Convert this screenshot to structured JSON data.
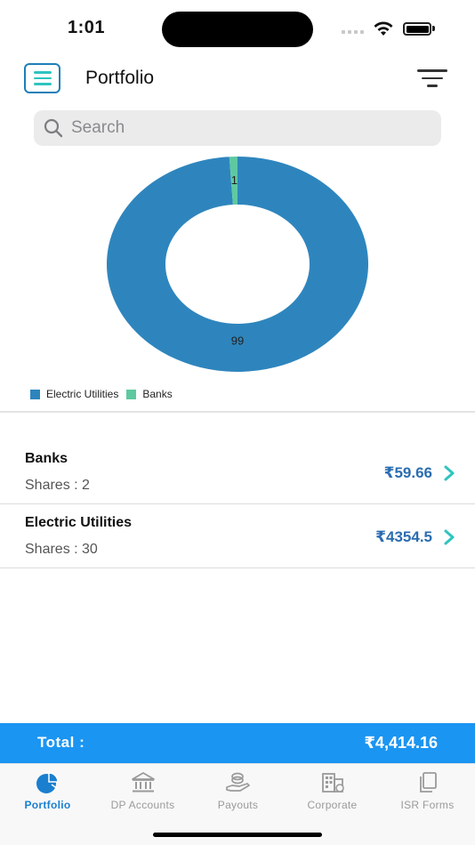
{
  "status_bar": {
    "time": "1:01"
  },
  "header": {
    "title": "Portfolio"
  },
  "search": {
    "placeholder": "Search"
  },
  "chart_data": {
    "type": "pie",
    "donut": true,
    "categories": [
      "Electric Utilities",
      "Banks"
    ],
    "values": [
      99,
      1
    ],
    "colors": [
      "#2e85bd",
      "#5ec9a0"
    ],
    "labels": [
      "99",
      "1"
    ],
    "legend_position": "bottom-left"
  },
  "holdings": [
    {
      "name": "Banks",
      "shares_label": "Shares : 2",
      "value": "₹59.66"
    },
    {
      "name": "Electric Utilities",
      "shares_label": "Shares : 30",
      "value": "₹4354.5"
    }
  ],
  "total": {
    "label": "Total :",
    "value": "₹4,414.16"
  },
  "tabs": [
    {
      "label": "Portfolio",
      "icon": "pie-chart-icon",
      "active": true
    },
    {
      "label": "DP Accounts",
      "icon": "bank-icon",
      "active": false
    },
    {
      "label": "Payouts",
      "icon": "hand-coins-icon",
      "active": false
    },
    {
      "label": "Corporate",
      "icon": "building-icon",
      "active": false
    },
    {
      "label": "ISR Forms",
      "icon": "copy-icon",
      "active": false
    }
  ],
  "colors": {
    "accent": "#1b95f2",
    "value_text": "#2a6db0",
    "chevron": "#2ec4c0"
  }
}
